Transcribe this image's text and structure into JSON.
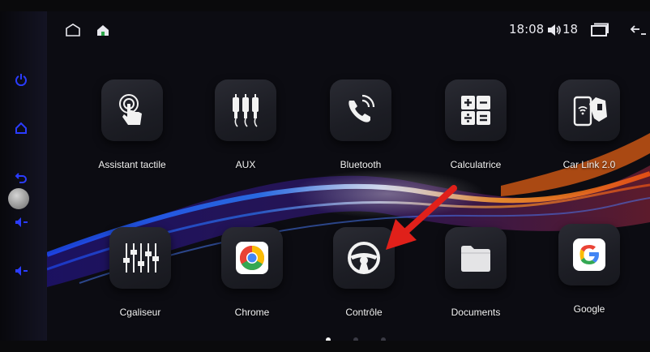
{
  "status_bar": {
    "time": "18:08",
    "volume_level": "18",
    "icons": [
      "home-outline-icon",
      "house-icon",
      "speaker-icon",
      "recent-apps-icon",
      "back-icon"
    ]
  },
  "side_keys": [
    "power-icon",
    "home-icon",
    "back-icon",
    "volume-down-icon",
    "volume-down-icon"
  ],
  "apps_row1": [
    {
      "label": "Assistant tactile",
      "icon": "touch-hand-icon"
    },
    {
      "label": "AUX",
      "icon": "rca-plugs-icon"
    },
    {
      "label": "Bluetooth",
      "icon": "phone-signal-icon"
    },
    {
      "label": "Calculatrice",
      "icon": "calculator-icon"
    },
    {
      "label": "Car Link 2.0",
      "icon": "car-link-icon"
    }
  ],
  "apps_row2": [
    {
      "label": "Cgaliseur",
      "icon": "equalizer-icon"
    },
    {
      "label": "Chrome",
      "icon": "chrome-icon"
    },
    {
      "label": "Contrôle",
      "icon": "steering-wheel-icon"
    },
    {
      "label": "Documents",
      "icon": "folder-icon"
    },
    {
      "label": "Google",
      "icon": "google-icon"
    }
  ],
  "page_indicator": {
    "count": 3,
    "active": 0
  },
  "colors": {
    "arrow": "#e0201a",
    "side_keys": "#2a3cff",
    "accent_orange": "#ff7a18"
  }
}
